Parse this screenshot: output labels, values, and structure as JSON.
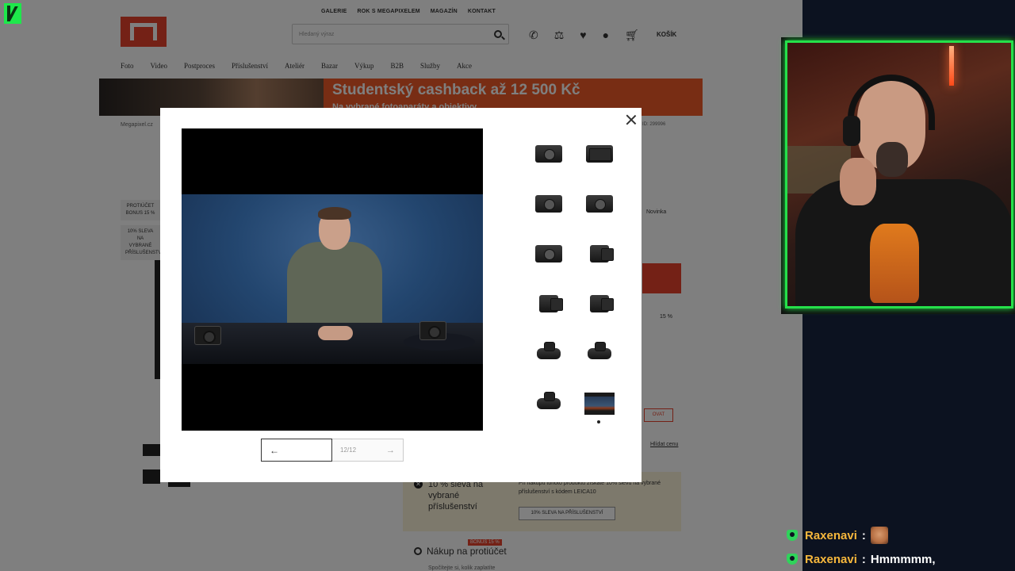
{
  "store": {
    "top_nav": [
      "GALERIE",
      "ROK S MEGAPIXELEM",
      "MAGAZÍN",
      "KONTAKT"
    ],
    "search_placeholder": "Hledaný výraz",
    "cart_label": "KOŠÍK",
    "category_nav": [
      "Foto",
      "Video",
      "Postproces",
      "Příslušenství",
      "Ateliér",
      "Bazar",
      "Výkup",
      "B2B",
      "Služby",
      "Akce"
    ],
    "banner": {
      "headline": "Studentský cashback až 12 500 Kč",
      "subline": "Na vybrané fotoaparáty a objektivy"
    },
    "breadcrumb": "Megapixel.cz",
    "product_id": "ID: 299996",
    "promo_tags": [
      "PROTIÚČET BONUS 15 %",
      "10% SLEVA NA VYBRANÉ PŘÍSLUŠENSTVÍ"
    ],
    "novinka": "Novinka",
    "bonus_percent": "15 %",
    "side_button": "OVAT",
    "watch_price": "Hlídat cenu",
    "promo": {
      "title": "10 % sleva na vybrané příslušenství",
      "description": "Při nákupu tohoto produktu získáte 10% slevu na vybrané příslušenství s kódem LEICA10",
      "button": "10% SLEVA NA PŘÍSLUŠENSTVÍ"
    },
    "tradein": {
      "badge": "BONUS 15 %",
      "title": "Nákup na protiúčet",
      "subtitle": "Spočítejte si, kolik zaplatíte"
    }
  },
  "gallery": {
    "counter": "12/12",
    "prev_arrow": "←",
    "next_arrow": "→",
    "thumbnails_count": 12,
    "active_index": 12
  },
  "chat": [
    {
      "user": "Raxenavi",
      "separator": ":",
      "message": "",
      "emote": "face-emote"
    },
    {
      "user": "Raxenavi",
      "separator": ":",
      "message": "Hmmmmm,",
      "emote": ""
    }
  ],
  "colors": {
    "brand": "#e8432c",
    "overlay_border": "#25e04a",
    "chat_user": "#f6b73c"
  }
}
